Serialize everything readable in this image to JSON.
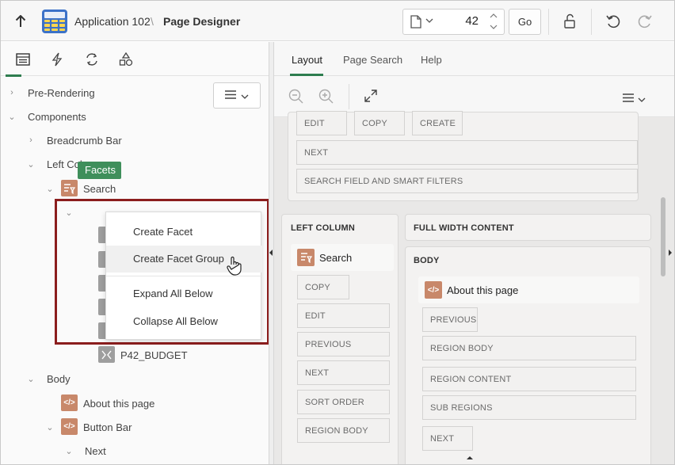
{
  "header": {
    "app_name": "Application 102",
    "separator": "\\",
    "page_title": "Page Designer",
    "page_number": "42",
    "go_label": "Go"
  },
  "left_panel": {
    "tabs": [
      "rendering-icon",
      "dynamic-actions-icon",
      "processing-icon",
      "shared-components-icon"
    ],
    "tree": {
      "pre_rendering": "Pre-Rendering",
      "components": "Components",
      "breadcrumb_bar": "Breadcrumb Bar",
      "left_column": "Left Column",
      "search": "Search",
      "facets": "Facets",
      "p42_budget": "P42_BUDGET",
      "body": "Body",
      "about_this_page": "About this page",
      "button_bar": "Button Bar",
      "next": "Next"
    },
    "context_menu": {
      "items": [
        "Create Facet",
        "Create Facet Group",
        "Expand All Below",
        "Collapse All Below"
      ]
    }
  },
  "right_panel": {
    "tabs": [
      "Layout",
      "Page Search",
      "Help"
    ],
    "active_tab": "Layout",
    "top_card": {
      "buttons": [
        "EDIT",
        "COPY",
        "CREATE"
      ],
      "rows": [
        "NEXT",
        "SEARCH FIELD AND SMART FILTERS"
      ]
    },
    "left_column": {
      "label": "LEFT COLUMN",
      "region": "Search",
      "slots": [
        "COPY",
        "EDIT",
        "PREVIOUS",
        "NEXT",
        "SORT ORDER",
        "REGION BODY"
      ]
    },
    "full_width": {
      "label": "FULL WIDTH CONTENT"
    },
    "body": {
      "label": "BODY",
      "region": "About this page",
      "slots": [
        "PREVIOUS",
        "REGION BODY",
        "REGION CONTENT",
        "SUB REGIONS",
        "NEXT"
      ]
    }
  },
  "colors": {
    "accent_green": "#2e7d4f",
    "selection_green": "#3f8f5b",
    "highlight_red": "#8b1d1d",
    "region_icon": "#c8886a"
  }
}
